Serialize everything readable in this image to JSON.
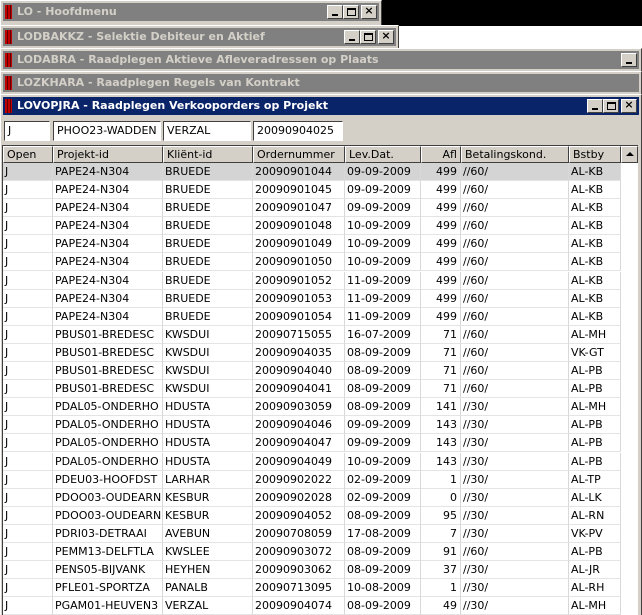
{
  "windows": [
    {
      "title": "LO - Hoofdmenu"
    },
    {
      "title": "LODBAKKZ - Selektie Debiteur en Aktief"
    },
    {
      "title": "LODABRA - Raadplegen Aktieve Afleveradressen op Plaats"
    },
    {
      "title": "LOZKHARA - Raadplegen Regels van Kontrakt"
    },
    {
      "title": "LOVOPJRA - Raadplegen Verkooporders op Projekt"
    }
  ],
  "filters": {
    "open": "J",
    "project": "PHOO23-WADDEN",
    "client": "VERZAL",
    "order": "20090904025"
  },
  "columns": [
    "Open",
    "Projekt-id",
    "Kliënt-id",
    "Ordernummer",
    "Lev.Dat.",
    "Afl",
    "Betalingskond.",
    "Bstby"
  ],
  "rows": [
    [
      "J",
      "PAPE24-N304",
      "BRUEDE",
      "20090901044",
      "09-09-2009",
      "499",
      "//60/",
      "AL-KB"
    ],
    [
      "J",
      "PAPE24-N304",
      "BRUEDE",
      "20090901045",
      "09-09-2009",
      "499",
      "//60/",
      "AL-KB"
    ],
    [
      "J",
      "PAPE24-N304",
      "BRUEDE",
      "20090901047",
      "09-09-2009",
      "499",
      "//60/",
      "AL-KB"
    ],
    [
      "J",
      "PAPE24-N304",
      "BRUEDE",
      "20090901048",
      "10-09-2009",
      "499",
      "//60/",
      "AL-KB"
    ],
    [
      "J",
      "PAPE24-N304",
      "BRUEDE",
      "20090901049",
      "10-09-2009",
      "499",
      "//60/",
      "AL-KB"
    ],
    [
      "J",
      "PAPE24-N304",
      "BRUEDE",
      "20090901050",
      "10-09-2009",
      "499",
      "//60/",
      "AL-KB"
    ],
    [
      "J",
      "PAPE24-N304",
      "BRUEDE",
      "20090901052",
      "11-09-2009",
      "499",
      "//60/",
      "AL-KB"
    ],
    [
      "J",
      "PAPE24-N304",
      "BRUEDE",
      "20090901053",
      "11-09-2009",
      "499",
      "//60/",
      "AL-KB"
    ],
    [
      "J",
      "PAPE24-N304",
      "BRUEDE",
      "20090901054",
      "11-09-2009",
      "499",
      "//60/",
      "AL-KB"
    ],
    [
      "J",
      "PBUS01-BREDESC",
      "KWSDUI",
      "20090715055",
      "16-07-2009",
      "71",
      "//60/",
      "AL-MH"
    ],
    [
      "J",
      "PBUS01-BREDESC",
      "KWSDUI",
      "20090904035",
      "08-09-2009",
      "71",
      "//60/",
      "VK-GT"
    ],
    [
      "J",
      "PBUS01-BREDESC",
      "KWSDUI",
      "20090904040",
      "08-09-2009",
      "71",
      "//60/",
      "AL-PB"
    ],
    [
      "J",
      "PBUS01-BREDESC",
      "KWSDUI",
      "20090904041",
      "08-09-2009",
      "71",
      "//60/",
      "AL-PB"
    ],
    [
      "J",
      "PDAL05-ONDERHO",
      "HDUSTA",
      "20090903059",
      "08-09-2009",
      "141",
      "//30/",
      "AL-MH"
    ],
    [
      "J",
      "PDAL05-ONDERHO",
      "HDUSTA",
      "20090904046",
      "09-09-2009",
      "143",
      "//30/",
      "AL-PB"
    ],
    [
      "J",
      "PDAL05-ONDERHO",
      "HDUSTA",
      "20090904047",
      "09-09-2009",
      "143",
      "//30/",
      "AL-PB"
    ],
    [
      "J",
      "PDAL05-ONDERHO",
      "HDUSTA",
      "20090904049",
      "10-09-2009",
      "143",
      "//30/",
      "AL-PB"
    ],
    [
      "J",
      "PDEU03-HOOFDST",
      "LARHAR",
      "20090902022",
      "02-09-2009",
      "1",
      "//30/",
      "AL-TP"
    ],
    [
      "J",
      "PDOO03-OUDEARN",
      "KESBUR",
      "20090902028",
      "02-09-2009",
      "0",
      "//30/",
      "AL-LK"
    ],
    [
      "J",
      "PDOO03-OUDEARN",
      "KESBUR",
      "20090904052",
      "08-09-2009",
      "95",
      "//30/",
      "AL-RN"
    ],
    [
      "J",
      "PDRI03-DETRAAI",
      "AVEBUN",
      "20090708059",
      "17-08-2009",
      "7",
      "//30/",
      "VK-PV"
    ],
    [
      "J",
      "PEMM13-DELFTLA",
      "KWSLEE",
      "20090903072",
      "08-09-2009",
      "91",
      "//60/",
      "AL-PB"
    ],
    [
      "J",
      "PENS05-BIJVANK",
      "HEYHEN",
      "20090903062",
      "08-09-2009",
      "37",
      "//30/",
      "AL-JR"
    ],
    [
      "J",
      "PFLE01-SPORTZA",
      "PANALB",
      "20090713095",
      "10-08-2009",
      "1",
      "//30/",
      "AL-RH"
    ],
    [
      "J",
      "PGAM01-HEUVEN3",
      "VERZAL",
      "20090904074",
      "08-09-2009",
      "49",
      "//30/",
      "AL-MH"
    ]
  ]
}
